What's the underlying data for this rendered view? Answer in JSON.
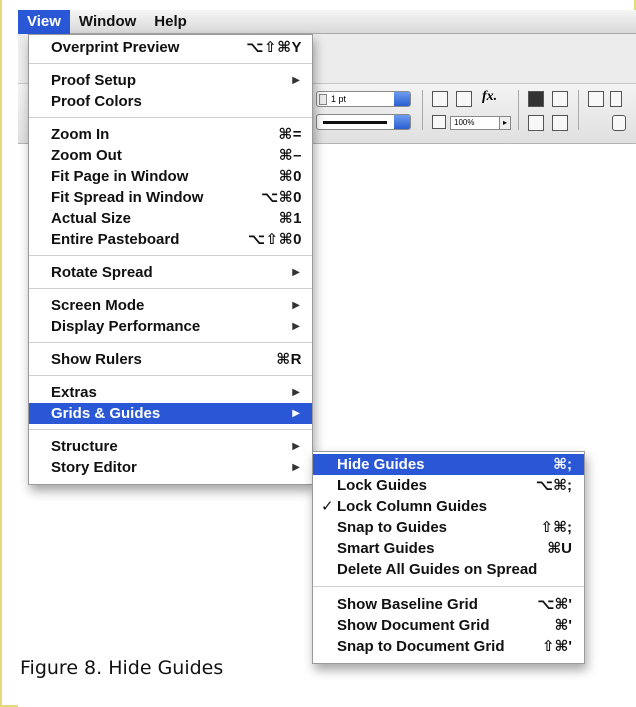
{
  "menubar": {
    "items": [
      {
        "label": "View",
        "active": true
      },
      {
        "label": "Window",
        "active": false
      },
      {
        "label": "Help",
        "active": false
      }
    ]
  },
  "toolbar": {
    "stroke_weight": "1 pt",
    "zoom_percent": "100%",
    "fx_label": "fx."
  },
  "view_menu": {
    "items": [
      {
        "label": "Overprint Preview",
        "shortcut": "⌥⇧⌘Y"
      },
      {
        "separator": true
      },
      {
        "label": "Proof Setup",
        "submenu": true
      },
      {
        "label": "Proof Colors"
      },
      {
        "separator": true
      },
      {
        "label": "Zoom In",
        "shortcut": "⌘="
      },
      {
        "label": "Zoom Out",
        "shortcut": "⌘–"
      },
      {
        "label": "Fit Page in Window",
        "shortcut": "⌘0"
      },
      {
        "label": "Fit Spread in Window",
        "shortcut": "⌥⌘0"
      },
      {
        "label": "Actual Size",
        "shortcut": "⌘1"
      },
      {
        "label": "Entire Pasteboard",
        "shortcut": "⌥⇧⌘0"
      },
      {
        "separator": true
      },
      {
        "label": "Rotate Spread",
        "submenu": true
      },
      {
        "separator": true
      },
      {
        "label": "Screen Mode",
        "submenu": true
      },
      {
        "label": "Display Performance",
        "submenu": true
      },
      {
        "separator": true
      },
      {
        "label": "Show Rulers",
        "shortcut": "⌘R"
      },
      {
        "separator": true
      },
      {
        "label": "Extras",
        "submenu": true
      },
      {
        "label": "Grids & Guides",
        "submenu": true,
        "highlighted": true
      },
      {
        "separator": true
      },
      {
        "label": "Structure",
        "submenu": true
      },
      {
        "label": "Story Editor",
        "submenu": true
      }
    ]
  },
  "grids_submenu": {
    "items": [
      {
        "label": "Hide Guides",
        "shortcut": "⌘;",
        "highlighted": true
      },
      {
        "label": "Lock Guides",
        "shortcut": "⌥⌘;"
      },
      {
        "label": "Lock Column Guides",
        "checked": true
      },
      {
        "label": "Snap to Guides",
        "shortcut": "⇧⌘;"
      },
      {
        "label": "Smart Guides",
        "shortcut": "⌘U"
      },
      {
        "label": "Delete All Guides on Spread"
      },
      {
        "separator": true
      },
      {
        "label": "Show Baseline Grid",
        "shortcut": "⌥⌘'"
      },
      {
        "label": "Show Document Grid",
        "shortcut": "⌘'"
      },
      {
        "label": "Snap to Document Grid",
        "shortcut": "⇧⌘'"
      }
    ]
  },
  "caption": "Figure 8. Hide Guides",
  "colors": {
    "highlight": "#2957d6",
    "frame_border": "#e6d97a"
  }
}
